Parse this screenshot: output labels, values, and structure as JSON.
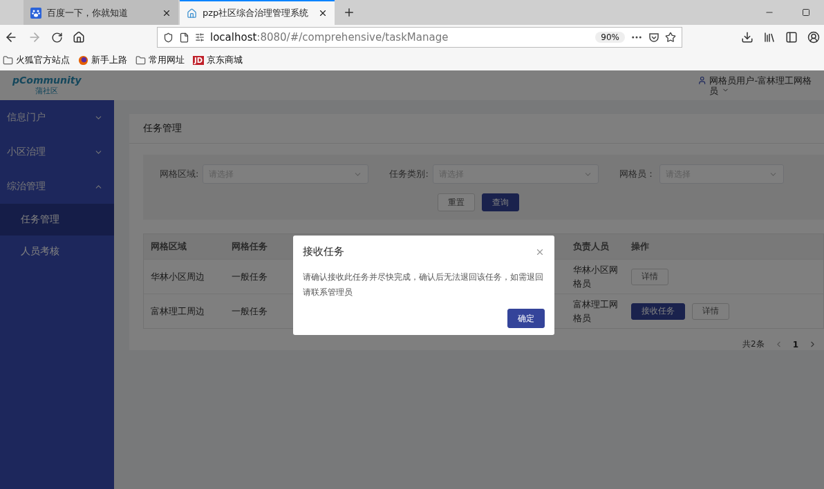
{
  "browser": {
    "tabs": [
      {
        "title": "百度一下，你就知道",
        "kind": "baidu",
        "selected": false
      },
      {
        "title": "pzp社区综合治理管理系统",
        "kind": "home",
        "selected": true
      }
    ],
    "url": {
      "host": "localhost",
      "path": ":8080/#/comprehensive/taskManage"
    },
    "zoom": "90%",
    "bookmarks": [
      {
        "label": "火狐官方站点",
        "kind": "folder"
      },
      {
        "label": "新手上路",
        "kind": "firefox"
      },
      {
        "label": "常用网址",
        "kind": "folder"
      },
      {
        "label": "京东商城",
        "kind": "jd",
        "icon_text": "JD"
      }
    ]
  },
  "app": {
    "logo": {
      "name": "pCommunity",
      "sub": "蒲社区"
    },
    "user": "网格员用户-富林理工网格员",
    "sidebar": [
      {
        "label": "信息门户",
        "expanded": false
      },
      {
        "label": "小区治理",
        "expanded": false
      },
      {
        "label": "综治管理",
        "expanded": true,
        "children": [
          {
            "label": "任务管理",
            "selected": true
          },
          {
            "label": "人员考核",
            "selected": false
          }
        ]
      }
    ],
    "page_title": "任务管理",
    "filters": [
      {
        "label": "网格区域:",
        "placeholder": "请选择"
      },
      {
        "label": "任务类别:",
        "placeholder": "请选择"
      },
      {
        "label": "网格员：",
        "placeholder": "请选择"
      }
    ],
    "filter_buttons": [
      {
        "label": "重置",
        "kind": "default"
      },
      {
        "label": "查询",
        "kind": "primary"
      }
    ],
    "table": {
      "columns": [
        "网格区域",
        "网格任务",
        "负责人员",
        "操作"
      ],
      "rows": [
        {
          "area": "华林小区周边",
          "task": "一般任务",
          "owner": "华林小区网格员",
          "actions": [
            {
              "label": "详情",
              "kind": "default"
            }
          ]
        },
        {
          "area": "富林理工周边",
          "task": "一般任务",
          "owner": "富林理工网格员",
          "actions": [
            {
              "label": "接收任务",
              "kind": "primary"
            },
            {
              "label": "详情",
              "kind": "default"
            }
          ]
        }
      ]
    },
    "pagination": {
      "total": "共2条",
      "pages": [
        {
          "label": "1",
          "selected": true
        }
      ]
    },
    "modal": {
      "title": "接收任务",
      "message": "请确认接收此任务并尽快完成，确认后无法退回该任务，如需退回请联系管理员",
      "confirm": "确定"
    }
  }
}
